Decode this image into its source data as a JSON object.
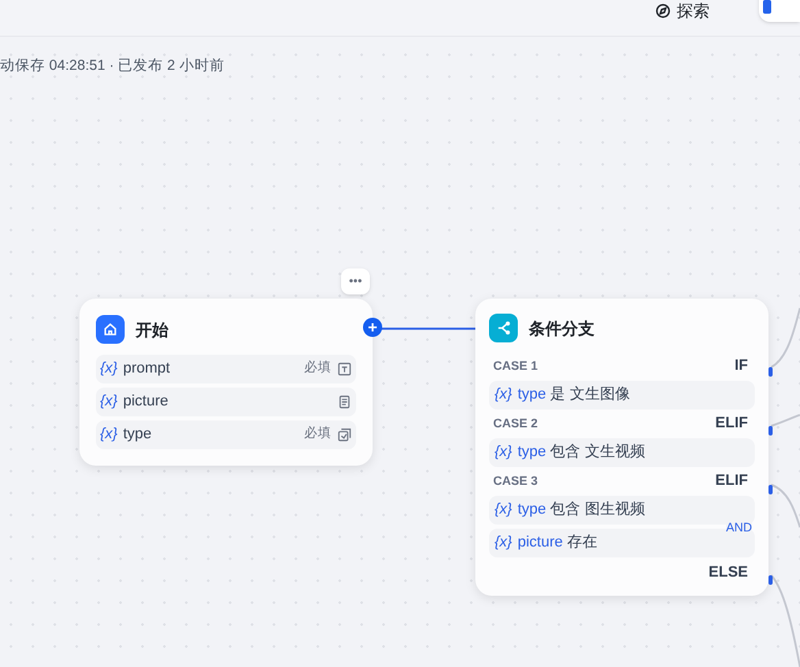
{
  "header": {
    "explore_label": "探索"
  },
  "status_text": "动保存 04:28:51 · 已发布 2 小时前",
  "start_node": {
    "title": "开始",
    "more_label": "•••",
    "connect_label": "+",
    "variables": [
      {
        "var_icon": "{x}",
        "name": "prompt",
        "required_label": "必填",
        "kind": "text"
      },
      {
        "var_icon": "{x}",
        "name": "picture",
        "kind": "file"
      },
      {
        "var_icon": "{x}",
        "name": "type",
        "required_label": "必填",
        "kind": "select"
      }
    ]
  },
  "branch_node": {
    "title": "条件分支",
    "cases": [
      {
        "label": "CASE 1",
        "branch": "IF",
        "conditions": [
          {
            "var_icon": "{x}",
            "var": "type",
            "op": "是",
            "value": "文生图像"
          }
        ]
      },
      {
        "label": "CASE 2",
        "branch": "ELIF",
        "conditions": [
          {
            "var_icon": "{x}",
            "var": "type",
            "op": "包含",
            "value": "文生视频"
          }
        ]
      },
      {
        "label": "CASE 3",
        "branch": "ELIF",
        "logic": "AND",
        "conditions": [
          {
            "var_icon": "{x}",
            "var": "type",
            "op": "包含",
            "value": "图生视频"
          },
          {
            "var_icon": "{x}",
            "var": "picture",
            "op": "存在"
          }
        ]
      }
    ],
    "else_label": "ELSE"
  }
}
